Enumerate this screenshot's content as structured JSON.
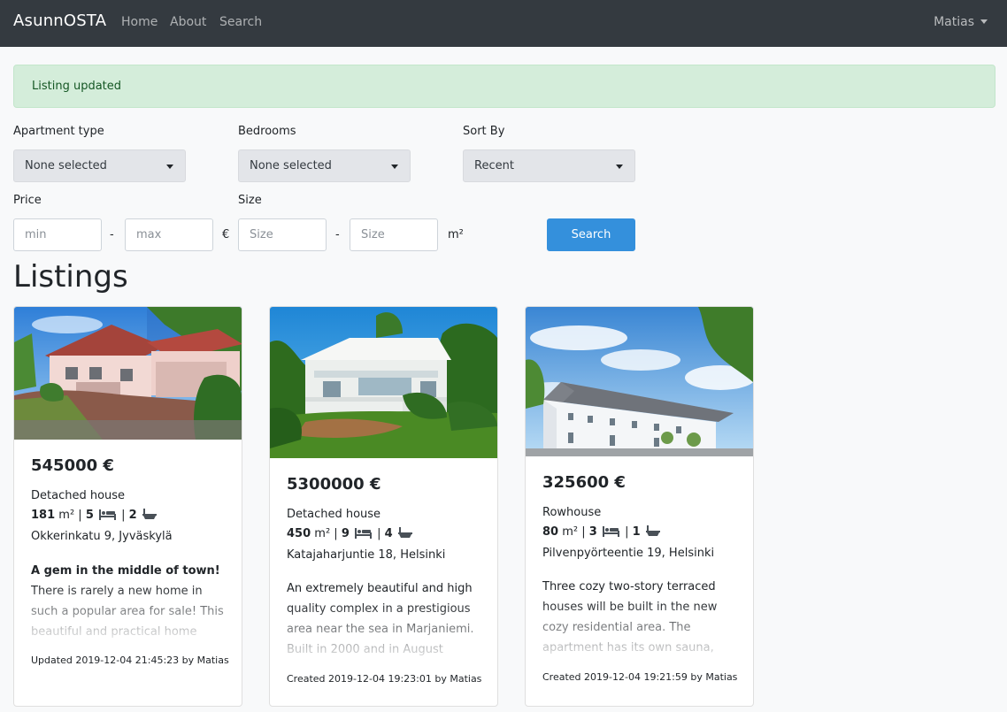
{
  "nav": {
    "brand": "AsunnOSTA",
    "links": [
      "Home",
      "About",
      "Search"
    ],
    "user": "Matias"
  },
  "alert": {
    "message": "Listing updated"
  },
  "filters": {
    "apartment_type": {
      "label": "Apartment type",
      "value": "None selected"
    },
    "bedrooms": {
      "label": "Bedrooms",
      "value": "None selected"
    },
    "sort_by": {
      "label": "Sort By",
      "value": "Recent"
    },
    "price": {
      "label": "Price",
      "min_placeholder": "min",
      "max_placeholder": "max",
      "unit": "€"
    },
    "size": {
      "label": "Size",
      "min_placeholder": "Size",
      "max_placeholder": "Size",
      "unit": "m²"
    },
    "separator": "-",
    "search_label": "Search"
  },
  "listings_title": "Listings",
  "listings": [
    {
      "price": "545000 €",
      "type": "Detached house",
      "area": "181",
      "area_unit": "m²",
      "bedrooms": "5",
      "bathrooms": "2",
      "address": "Okkerinkatu 9, Jyväskylä",
      "desc_title": "A gem in the middle of town!",
      "description": "There is rarely a new home in such a popular area for sale! This beautiful and practical home",
      "meta": "Updated 2019-12-04 21:45:23 by Matias"
    },
    {
      "price": "5300000 €",
      "type": "Detached house",
      "area": "450",
      "area_unit": "m²",
      "bedrooms": "9",
      "bathrooms": "4",
      "address": "Katajaharjuntie 18, Helsinki",
      "desc_title": "",
      "description": "An extremely beautiful and high quality complex in a prestigious area near the sea in Marjaniemi. Built in 2000 and in August",
      "meta": "Created 2019-12-04 19:23:01 by Matias"
    },
    {
      "price": "325600 €",
      "type": "Rowhouse",
      "area": "80",
      "area_unit": "m²",
      "bedrooms": "3",
      "bathrooms": "1",
      "address": "Pilvenpyörteentie 19, Helsinki",
      "desc_title": "",
      "description": "Three cozy two-story terraced houses will be built in the new cozy residential area. The apartment has its own sauna,",
      "meta": "Created 2019-12-04 19:21:59 by Matias"
    }
  ],
  "colors": {
    "navbar": "#343a40",
    "alert_bg": "#d4edda",
    "alert_text": "#155724",
    "button": "#3490dc"
  },
  "icons": [
    "bed-icon",
    "bath-icon",
    "caret-down-icon"
  ]
}
